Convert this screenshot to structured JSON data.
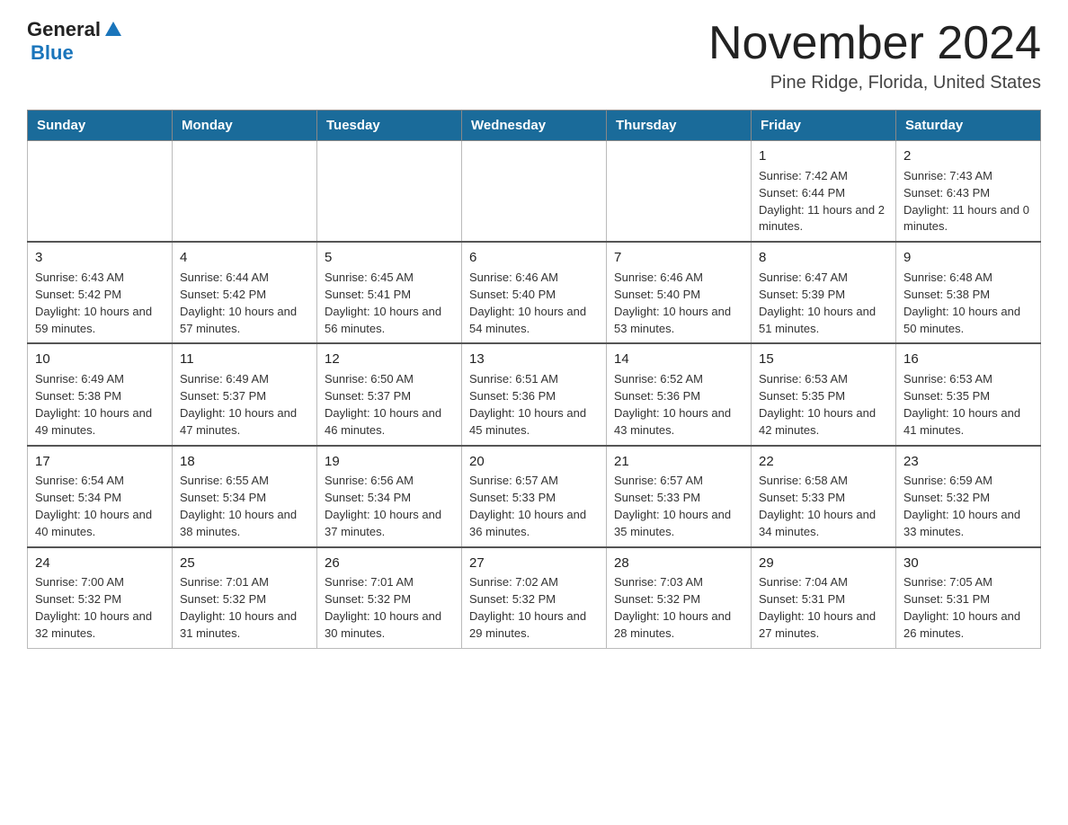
{
  "header": {
    "logo_general": "General",
    "logo_blue": "Blue",
    "month_title": "November 2024",
    "location": "Pine Ridge, Florida, United States"
  },
  "weekdays": [
    "Sunday",
    "Monday",
    "Tuesday",
    "Wednesday",
    "Thursday",
    "Friday",
    "Saturday"
  ],
  "weeks": [
    [
      {
        "day": "",
        "info": ""
      },
      {
        "day": "",
        "info": ""
      },
      {
        "day": "",
        "info": ""
      },
      {
        "day": "",
        "info": ""
      },
      {
        "day": "",
        "info": ""
      },
      {
        "day": "1",
        "info": "Sunrise: 7:42 AM\nSunset: 6:44 PM\nDaylight: 11 hours and 2 minutes."
      },
      {
        "day": "2",
        "info": "Sunrise: 7:43 AM\nSunset: 6:43 PM\nDaylight: 11 hours and 0 minutes."
      }
    ],
    [
      {
        "day": "3",
        "info": "Sunrise: 6:43 AM\nSunset: 5:42 PM\nDaylight: 10 hours and 59 minutes."
      },
      {
        "day": "4",
        "info": "Sunrise: 6:44 AM\nSunset: 5:42 PM\nDaylight: 10 hours and 57 minutes."
      },
      {
        "day": "5",
        "info": "Sunrise: 6:45 AM\nSunset: 5:41 PM\nDaylight: 10 hours and 56 minutes."
      },
      {
        "day": "6",
        "info": "Sunrise: 6:46 AM\nSunset: 5:40 PM\nDaylight: 10 hours and 54 minutes."
      },
      {
        "day": "7",
        "info": "Sunrise: 6:46 AM\nSunset: 5:40 PM\nDaylight: 10 hours and 53 minutes."
      },
      {
        "day": "8",
        "info": "Sunrise: 6:47 AM\nSunset: 5:39 PM\nDaylight: 10 hours and 51 minutes."
      },
      {
        "day": "9",
        "info": "Sunrise: 6:48 AM\nSunset: 5:38 PM\nDaylight: 10 hours and 50 minutes."
      }
    ],
    [
      {
        "day": "10",
        "info": "Sunrise: 6:49 AM\nSunset: 5:38 PM\nDaylight: 10 hours and 49 minutes."
      },
      {
        "day": "11",
        "info": "Sunrise: 6:49 AM\nSunset: 5:37 PM\nDaylight: 10 hours and 47 minutes."
      },
      {
        "day": "12",
        "info": "Sunrise: 6:50 AM\nSunset: 5:37 PM\nDaylight: 10 hours and 46 minutes."
      },
      {
        "day": "13",
        "info": "Sunrise: 6:51 AM\nSunset: 5:36 PM\nDaylight: 10 hours and 45 minutes."
      },
      {
        "day": "14",
        "info": "Sunrise: 6:52 AM\nSunset: 5:36 PM\nDaylight: 10 hours and 43 minutes."
      },
      {
        "day": "15",
        "info": "Sunrise: 6:53 AM\nSunset: 5:35 PM\nDaylight: 10 hours and 42 minutes."
      },
      {
        "day": "16",
        "info": "Sunrise: 6:53 AM\nSunset: 5:35 PM\nDaylight: 10 hours and 41 minutes."
      }
    ],
    [
      {
        "day": "17",
        "info": "Sunrise: 6:54 AM\nSunset: 5:34 PM\nDaylight: 10 hours and 40 minutes."
      },
      {
        "day": "18",
        "info": "Sunrise: 6:55 AM\nSunset: 5:34 PM\nDaylight: 10 hours and 38 minutes."
      },
      {
        "day": "19",
        "info": "Sunrise: 6:56 AM\nSunset: 5:34 PM\nDaylight: 10 hours and 37 minutes."
      },
      {
        "day": "20",
        "info": "Sunrise: 6:57 AM\nSunset: 5:33 PM\nDaylight: 10 hours and 36 minutes."
      },
      {
        "day": "21",
        "info": "Sunrise: 6:57 AM\nSunset: 5:33 PM\nDaylight: 10 hours and 35 minutes."
      },
      {
        "day": "22",
        "info": "Sunrise: 6:58 AM\nSunset: 5:33 PM\nDaylight: 10 hours and 34 minutes."
      },
      {
        "day": "23",
        "info": "Sunrise: 6:59 AM\nSunset: 5:32 PM\nDaylight: 10 hours and 33 minutes."
      }
    ],
    [
      {
        "day": "24",
        "info": "Sunrise: 7:00 AM\nSunset: 5:32 PM\nDaylight: 10 hours and 32 minutes."
      },
      {
        "day": "25",
        "info": "Sunrise: 7:01 AM\nSunset: 5:32 PM\nDaylight: 10 hours and 31 minutes."
      },
      {
        "day": "26",
        "info": "Sunrise: 7:01 AM\nSunset: 5:32 PM\nDaylight: 10 hours and 30 minutes."
      },
      {
        "day": "27",
        "info": "Sunrise: 7:02 AM\nSunset: 5:32 PM\nDaylight: 10 hours and 29 minutes."
      },
      {
        "day": "28",
        "info": "Sunrise: 7:03 AM\nSunset: 5:32 PM\nDaylight: 10 hours and 28 minutes."
      },
      {
        "day": "29",
        "info": "Sunrise: 7:04 AM\nSunset: 5:31 PM\nDaylight: 10 hours and 27 minutes."
      },
      {
        "day": "30",
        "info": "Sunrise: 7:05 AM\nSunset: 5:31 PM\nDaylight: 10 hours and 26 minutes."
      }
    ]
  ]
}
